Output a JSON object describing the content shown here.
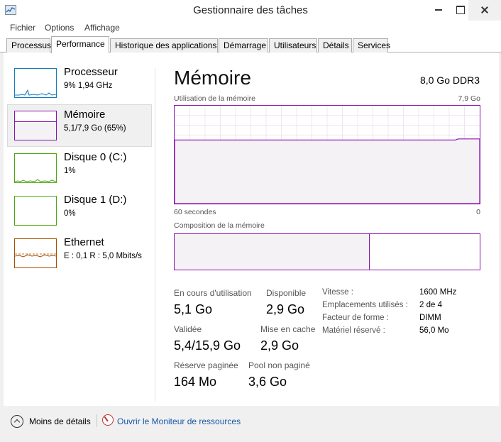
{
  "window": {
    "title": "Gestionnaire des tâches"
  },
  "colors": {
    "memory": "#8b12ae",
    "cpu": "#117dbb",
    "disk": "#4da60c",
    "ethernet": "#a74f01"
  },
  "menu": [
    "Fichier",
    "Options",
    "Affichage"
  ],
  "tabs": [
    "Processus",
    "Performance",
    "Historique des applications",
    "Démarrage",
    "Utilisateurs",
    "Détails",
    "Services"
  ],
  "active_tab": "Performance",
  "sidebar": {
    "items": [
      {
        "name": "Processeur",
        "sub": "9%  1,94 GHz",
        "icon": "cpu-graph-icon"
      },
      {
        "name": "Mémoire",
        "sub": "5,1/7,9 Go (65%)",
        "icon": "memory-graph-icon"
      },
      {
        "name": "Disque 0 (C:)",
        "sub": "1%",
        "icon": "disk-graph-icon"
      },
      {
        "name": "Disque 1 (D:)",
        "sub": "0%",
        "icon": "disk-graph-icon"
      },
      {
        "name": "Ethernet",
        "sub": "E : 0,1  R : 5,0 Mbits/s",
        "icon": "ethernet-graph-icon"
      }
    ]
  },
  "main": {
    "title": "Mémoire",
    "spec": "8,0 Go DDR3",
    "usage_label": "Utilisation de la mémoire",
    "usage_max": "7,9 Go",
    "usage_fraction": 0.65,
    "time_left": "60 secondes",
    "time_right": "0",
    "composition_label": "Composition de la mémoire",
    "composition_used_fraction": 0.64
  },
  "stats": {
    "in_use_label": "En cours d'utilisation",
    "in_use": "5,1 Go",
    "available_label": "Disponible",
    "available": "2,9 Go",
    "committed_label": "Validée",
    "committed": "5,4/15,9 Go",
    "cached_label": "Mise en cache",
    "cached": "2,9 Go",
    "paged_label": "Réserve paginée",
    "paged": "164 Mo",
    "nonpaged_label": "Pool non paginé",
    "nonpaged": "3,6 Go"
  },
  "details": [
    {
      "label": "Vitesse :",
      "value": "1600 MHz"
    },
    {
      "label": "Emplacements utilisés :",
      "value": "2 de 4"
    },
    {
      "label": "Facteur de forme :",
      "value": "DIMM"
    },
    {
      "label": "Matériel réservé :",
      "value": "56,0 Mo"
    }
  ],
  "footer": {
    "fewer_details": "Moins de détails",
    "monitor_link": "Ouvrir le Moniteur de ressources"
  }
}
